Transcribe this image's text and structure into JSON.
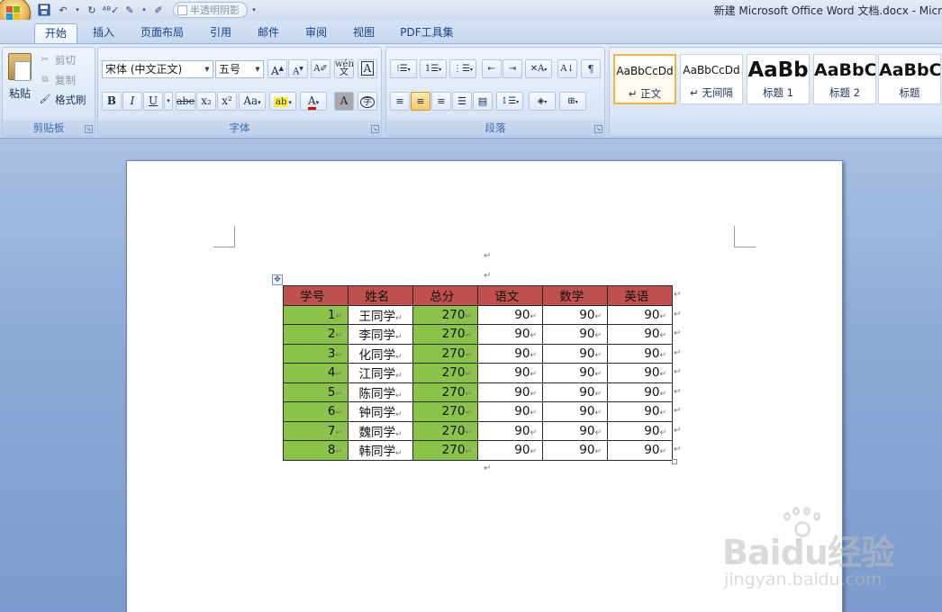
{
  "title": "新建 Microsoft Office Word 文档.docx - Micr",
  "qat": {
    "checkbox_label": "半透明阴影"
  },
  "tabs": [
    "开始",
    "插入",
    "页面布局",
    "引用",
    "邮件",
    "审阅",
    "视图",
    "PDF工具集"
  ],
  "clipboard": {
    "paste": "粘贴",
    "cut": "剪切",
    "copy": "复制",
    "format_painter": "格式刷",
    "label": "剪贴板"
  },
  "font": {
    "name": "宋体 (中文正文)",
    "size": "五号",
    "label": "字体",
    "buttons": {
      "bold": "B",
      "italic": "I",
      "underline": "U",
      "strike": "abe",
      "subscript": "x₂",
      "superscript": "x²",
      "change_case": "Aa",
      "grow": "A",
      "shrink": "A",
      "clear": "A",
      "phonetic": "wén\n文",
      "border_char": "A",
      "shade_char": "A",
      "enclose": "字"
    }
  },
  "paragraph": {
    "label": "段落"
  },
  "styles": [
    {
      "preview": "AaBbCcDd",
      "name": "↵ 正文"
    },
    {
      "preview": "AaBbCcDd",
      "name": "↵ 无间隔"
    },
    {
      "preview": "AaBb",
      "name": "标题 1"
    },
    {
      "preview": "AaBbC",
      "name": "标题 2"
    },
    {
      "preview": "AaBbC",
      "name": "标题"
    }
  ],
  "colors": {
    "header": "#c0504d",
    "green": "#8bc34a"
  },
  "table": {
    "headers": [
      "学号",
      "姓名",
      "总分",
      "语文",
      "数学",
      "英语"
    ],
    "rows": [
      [
        "1",
        "王同学",
        "270",
        "90",
        "90",
        "90"
      ],
      [
        "2",
        "李同学",
        "270",
        "90",
        "90",
        "90"
      ],
      [
        "3",
        "化同学",
        "270",
        "90",
        "90",
        "90"
      ],
      [
        "4",
        "江同学",
        "270",
        "90",
        "90",
        "90"
      ],
      [
        "5",
        "陈同学",
        "270",
        "90",
        "90",
        "90"
      ],
      [
        "6",
        "钟同学",
        "270",
        "90",
        "90",
        "90"
      ],
      [
        "7",
        "魏同学",
        "270",
        "90",
        "90",
        "90"
      ],
      [
        "8",
        "韩同学",
        "270",
        "90",
        "90",
        "90"
      ]
    ]
  },
  "watermark": {
    "brand": "Baidu经验",
    "url": "jingyan.baidu.com"
  }
}
